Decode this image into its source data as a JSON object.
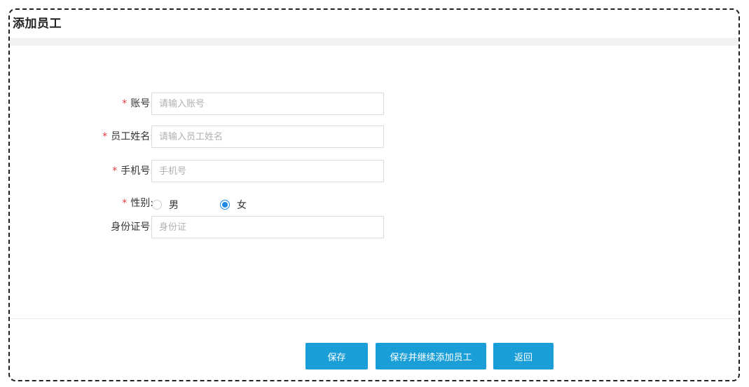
{
  "page": {
    "title": "添加员工"
  },
  "form": {
    "account": {
      "label": "账号:",
      "required_mark": "*",
      "placeholder": "请输入账号",
      "value": ""
    },
    "name": {
      "label": "员工姓名:",
      "required_mark": "*",
      "placeholder": "请输入员工姓名",
      "value": ""
    },
    "phone": {
      "label": "手机号:",
      "required_mark": "*",
      "placeholder": "手机号",
      "value": ""
    },
    "gender": {
      "label": "性别:",
      "required_mark": "*",
      "options": [
        {
          "label": "男",
          "selected": false
        },
        {
          "label": "女",
          "selected": true
        }
      ]
    },
    "id_card": {
      "label": "身份证号:",
      "placeholder": "身份证",
      "value": ""
    }
  },
  "actions": {
    "save_label": "保存",
    "save_continue_label": "保存并继续添加员工",
    "back_label": "返回"
  },
  "colors": {
    "primary_button": "#1a9ed8",
    "required_mark": "#e4393c",
    "radio_selected": "#1e88e5"
  }
}
